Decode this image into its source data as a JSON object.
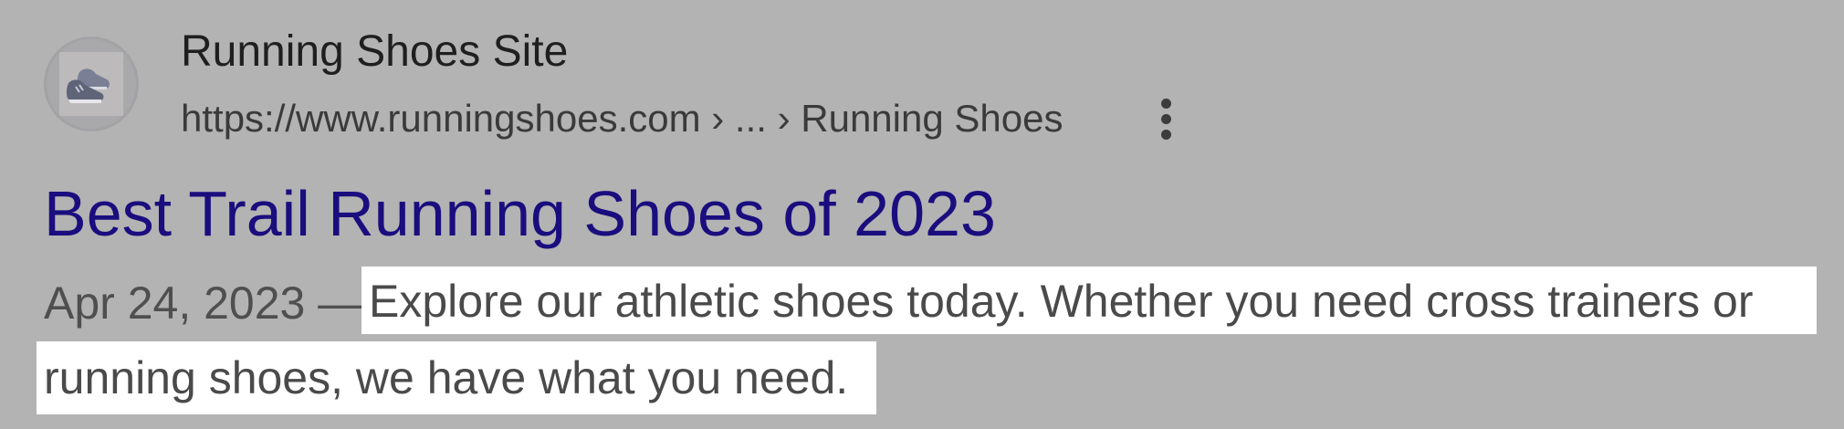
{
  "result": {
    "site_name": "Running Shoes Site",
    "url": "https://www.runningshoes.com › ... › Running Shoes",
    "favicon_icon": "running-shoe-icon",
    "more_icon": "vertical-dots-icon",
    "title": "Best Trail Running Shoes of 2023",
    "title_color": "#1a0d7e",
    "date": "Apr 24, 2023 —",
    "snippet_line1": "Explore our athletic shoes today. Whether you need cross trainers or",
    "snippet_line2": "running shoes, we have what you need.",
    "highlight_color": "#ffffff",
    "background_color": "#b3b3b3"
  }
}
